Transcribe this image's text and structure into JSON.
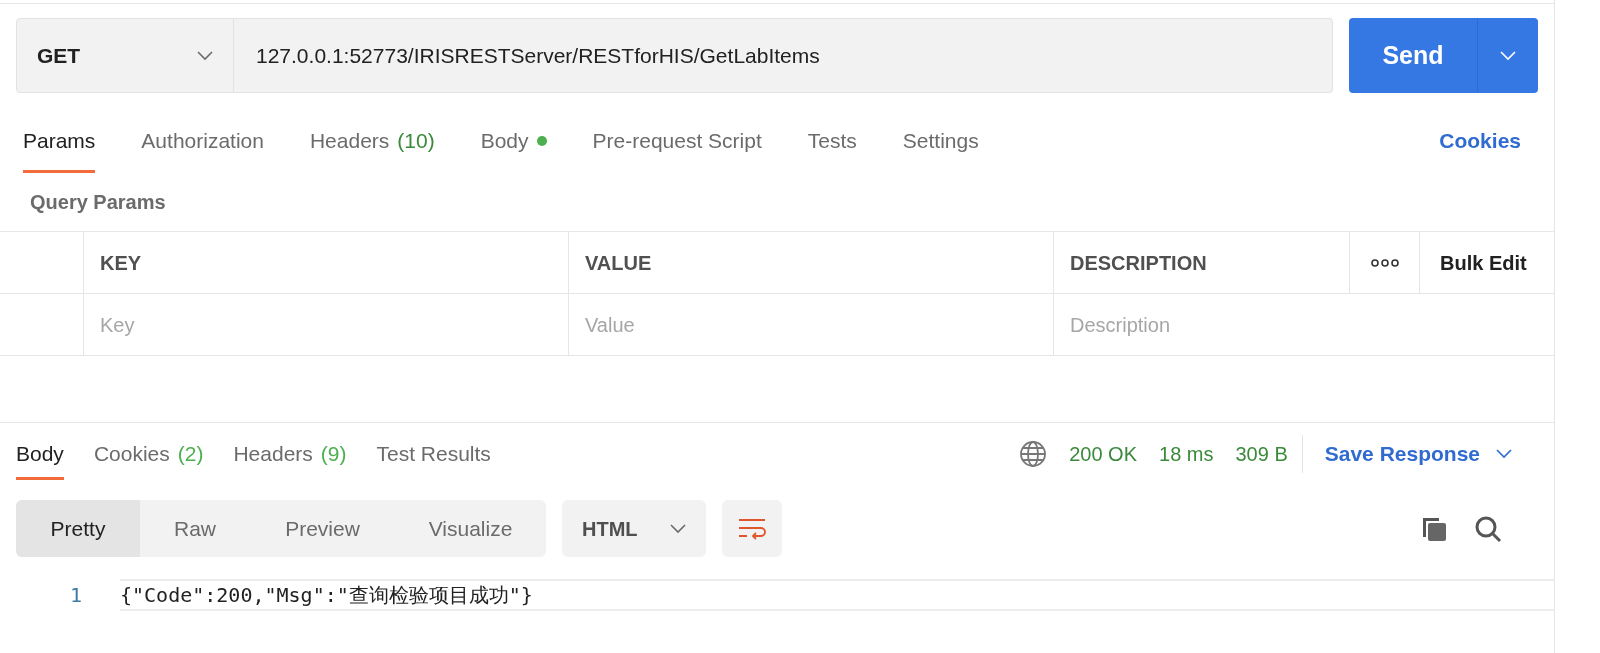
{
  "request": {
    "method": "GET",
    "url": "127.0.0.1:52773/IRISRESTServer/RESTforHIS/GetLabItems",
    "send_label": "Send"
  },
  "request_tabs": [
    {
      "label": "Params",
      "dot": false,
      "selected": true
    },
    {
      "label": "Authorization",
      "dot": false,
      "selected": false
    },
    {
      "label": "Headers",
      "count": "(10)",
      "dot": false,
      "selected": false
    },
    {
      "label": "Body",
      "dot": true,
      "selected": false
    },
    {
      "label": "Pre-request Script",
      "dot": false,
      "selected": false
    },
    {
      "label": "Tests",
      "dot": false,
      "selected": false
    },
    {
      "label": "Settings",
      "dot": false,
      "selected": false
    }
  ],
  "cookies_link": "Cookies",
  "query_params": {
    "title": "Query Params",
    "columns": [
      "KEY",
      "VALUE",
      "DESCRIPTION"
    ],
    "bulk_edit": "Bulk Edit",
    "placeholders": [
      "Key",
      "Value",
      "Description"
    ]
  },
  "response_tabs": [
    {
      "label": "Body",
      "selected": true
    },
    {
      "label": "Cookies",
      "count": "(2)",
      "selected": false
    },
    {
      "label": "Headers",
      "count": "(9)",
      "selected": false
    },
    {
      "label": "Test Results",
      "selected": false
    }
  ],
  "status": {
    "code": "200 OK",
    "time": "18 ms",
    "size": "309 B",
    "save": "Save Response"
  },
  "view_modes": [
    {
      "label": "Pretty",
      "selected": true
    },
    {
      "label": "Raw",
      "selected": false
    },
    {
      "label": "Preview",
      "selected": false
    },
    {
      "label": "Visualize",
      "selected": false
    }
  ],
  "language": "HTML",
  "code_lines": [
    {
      "number": "1",
      "text": "{\"Code\":200,\"Msg\":\"查询检验项目成功\"}"
    }
  ]
}
